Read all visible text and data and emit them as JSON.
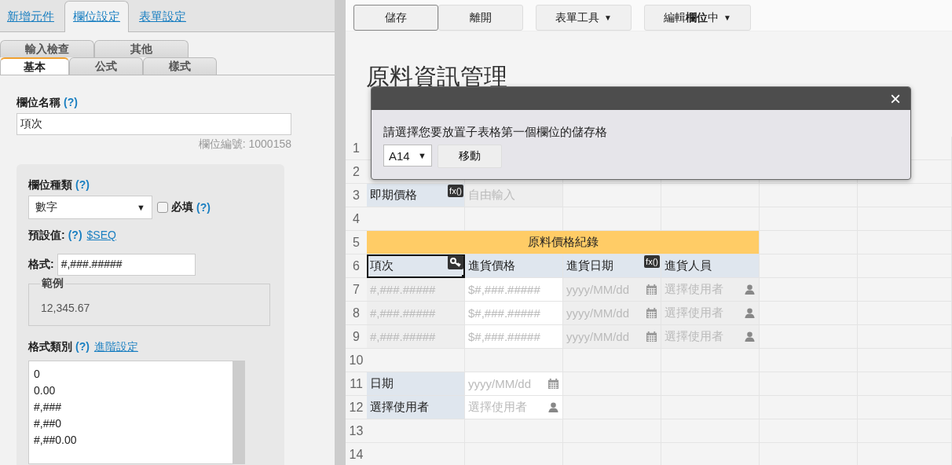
{
  "left_panel": {
    "top_tabs": [
      {
        "label": "新增元件",
        "selected": false
      },
      {
        "label": "欄位設定",
        "selected": true
      },
      {
        "label": "表單設定",
        "selected": false
      }
    ],
    "sub_tab_rows": [
      [
        {
          "label": "輸入檢查",
          "selected": false
        },
        {
          "label": "其他",
          "selected": false
        }
      ],
      [
        {
          "label": "基本",
          "selected": true
        },
        {
          "label": "公式",
          "selected": false
        },
        {
          "label": "樣式",
          "selected": false
        }
      ]
    ],
    "field_name": {
      "label": "欄位名稱",
      "help": "(?)",
      "value": "項次",
      "field_id": "欄位編號: 1000158"
    },
    "field_type": {
      "label": "欄位種類",
      "help": "(?)",
      "value": "數字",
      "caret": "▼",
      "required_label": "必填",
      "required_help": "(?)",
      "required_checked": false
    },
    "default_value": {
      "label": "預設值:",
      "help": "(?)",
      "link": "$SEQ"
    },
    "format": {
      "label": "格式:",
      "value": "#,###.#####"
    },
    "example": {
      "legend": "範例",
      "value": "12,345.67"
    },
    "format_category": {
      "label": "格式類別",
      "help": "(?)",
      "link": "進階設定",
      "options": [
        "0",
        "0.00",
        "#,###",
        "#,##0",
        "#,##0.00"
      ]
    }
  },
  "toolbar": {
    "buttons": [
      {
        "label": "儲存",
        "kind": "plain",
        "focused": true
      },
      {
        "label": "離開",
        "kind": "plain",
        "focused": false
      },
      {
        "label": "表單工具",
        "kind": "menu",
        "caret": "▼",
        "focused": false
      },
      {
        "label": "編輯**欄位**中",
        "kind": "menu",
        "caret": "▼",
        "focused": false
      }
    ]
  },
  "form_title": "原料資訊管理",
  "grid": {
    "rows": [
      {
        "number": "1",
        "cells": []
      },
      {
        "number": "2",
        "cells": []
      },
      {
        "number": "3",
        "cells": [
          {
            "kind": "label",
            "text": "即期價格",
            "badge": {
              "kind": "text",
              "text": "fx()"
            }
          },
          {
            "kind": "text_input",
            "text": "自由輸入",
            "readonly": true
          }
        ]
      },
      {
        "number": "4",
        "cells": []
      },
      {
        "number": "5",
        "cells": [
          {
            "kind": "section",
            "text": "原料價格紀錄"
          }
        ]
      },
      {
        "number": "6",
        "cells": [
          {
            "kind": "label",
            "text": "項次",
            "selected": true,
            "badge": {
              "kind": "key"
            }
          },
          {
            "kind": "label",
            "text": "進貨價格",
            "selected": false
          },
          {
            "kind": "label",
            "text": "進貨日期",
            "selected": false,
            "badge": {
              "kind": "text",
              "text": "fx()"
            }
          },
          {
            "kind": "label",
            "text": "進貨人員",
            "selected": false
          }
        ]
      },
      {
        "number": "7",
        "cells": [
          {
            "kind": "text_input",
            "text": "#,###.#####",
            "readonly": true
          },
          {
            "kind": "text_input",
            "text": "$#,###.#####",
            "readonly": false
          },
          {
            "kind": "date_input",
            "text": "yyyy/MM/dd",
            "readonly": true
          },
          {
            "kind": "user_input",
            "text": "選擇使用者",
            "readonly": true
          }
        ]
      },
      {
        "number": "8",
        "cells": [
          {
            "kind": "text_input",
            "text": "#,###.#####",
            "readonly": true
          },
          {
            "kind": "text_input",
            "text": "$#,###.#####",
            "readonly": false
          },
          {
            "kind": "date_input",
            "text": "yyyy/MM/dd",
            "readonly": true
          },
          {
            "kind": "user_input",
            "text": "選擇使用者",
            "readonly": true
          }
        ]
      },
      {
        "number": "9",
        "cells": [
          {
            "kind": "text_input",
            "text": "#,###.#####",
            "readonly": true
          },
          {
            "kind": "text_input",
            "text": "$#,###.#####",
            "readonly": false
          },
          {
            "kind": "date_input",
            "text": "yyyy/MM/dd",
            "readonly": true
          },
          {
            "kind": "user_input",
            "text": "選擇使用者",
            "readonly": true
          }
        ]
      },
      {
        "number": "10",
        "cells": []
      },
      {
        "number": "11",
        "cells": [
          {
            "kind": "label",
            "text": "日期"
          },
          {
            "kind": "date_input",
            "text": "yyyy/MM/dd",
            "readonly": false
          }
        ]
      },
      {
        "number": "12",
        "cells": [
          {
            "kind": "label",
            "text": "選擇使用者"
          },
          {
            "kind": "user_input",
            "text": "選擇使用者",
            "readonly": false
          }
        ]
      },
      {
        "number": "13",
        "cells": []
      },
      {
        "number": "14",
        "cells": []
      }
    ]
  },
  "dialog": {
    "close": "×",
    "message": "請選擇您要放置子表格第一個欄位的儲存格",
    "select": {
      "value": "A14",
      "caret": "▼"
    },
    "button": "移動"
  }
}
